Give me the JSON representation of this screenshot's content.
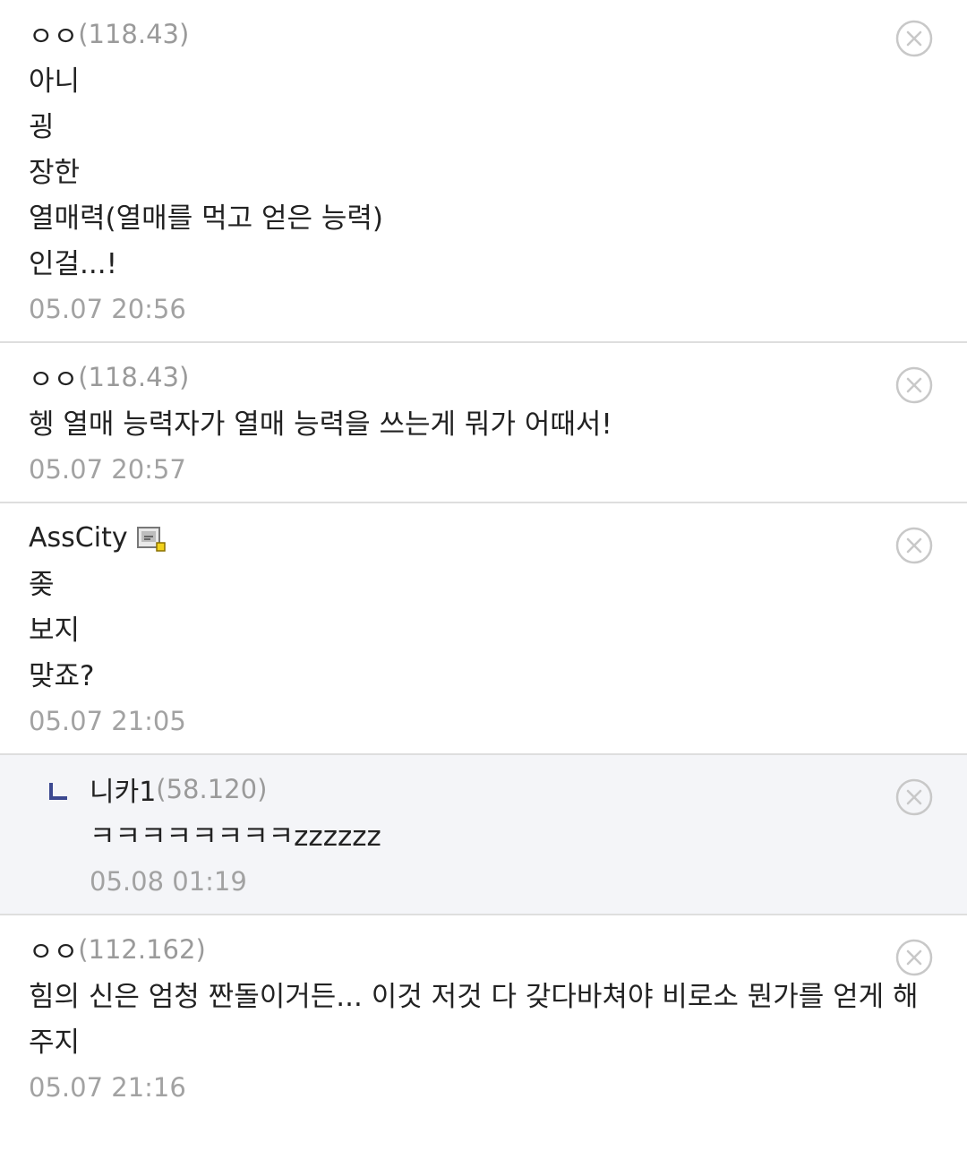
{
  "comments": [
    {
      "nick": "ㅇㅇ",
      "ip": "(118.43)",
      "lines": [
        "아니",
        "굉",
        "장한",
        "열매력(열매를 먹고 얻은 능력)",
        "인걸...!"
      ],
      "date": "05.07 20:56"
    },
    {
      "nick": "ㅇㅇ",
      "ip": "(118.43)",
      "lines": [
        "헹 열매 능력자가 열매 능력을 쓰는게 뭐가 어때서!"
      ],
      "date": "05.07 20:57"
    },
    {
      "nick": "AssCity",
      "lines": [
        "좆",
        "보지",
        "맞죠?"
      ],
      "date": "05.07 21:05",
      "icon": "fixed-nick-badge-icon"
    },
    {
      "nick": "니카1",
      "ip": "(58.120)",
      "lines": [
        "ㅋㅋㅋㅋㅋㅋㅋㅋzzzzzz"
      ],
      "date": "05.08 01:19",
      "reply": true
    },
    {
      "nick": "ㅇㅇ",
      "ip": "(112.162)",
      "lines": [
        "힘의 신은 엄청 짠돌이거든... 이것 저것 다 갖다바쳐야 비로소 뭔가를 얻게 해 주지"
      ],
      "date": "05.07 21:16"
    }
  ],
  "icons": {
    "delete": "close-circle-icon",
    "reply": "reply-arrow-icon"
  },
  "colors": {
    "reply_background": "#f4f5f8",
    "reply_marker": "#3b4890",
    "divider": "#dedede",
    "meta_text": "#9a9a9a"
  }
}
